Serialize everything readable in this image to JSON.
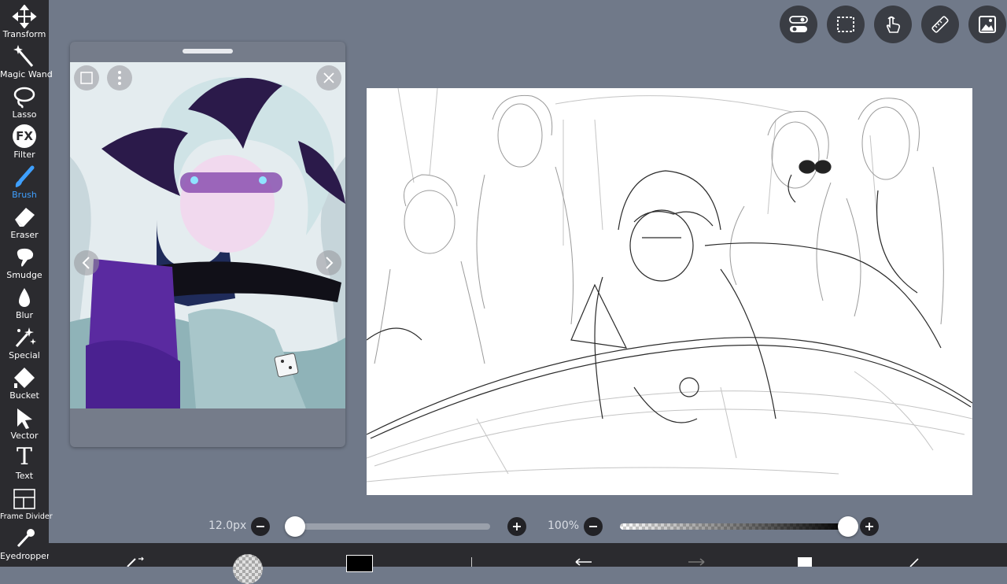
{
  "toolbar": {
    "tools": [
      {
        "label": "Transform",
        "icon": "move-arrows-icon"
      },
      {
        "label": "Magic Wand",
        "icon": "magic-wand-icon"
      },
      {
        "label": "Lasso",
        "icon": "lasso-icon"
      },
      {
        "label": "Filter",
        "icon": "fx-icon",
        "glyph": "FX"
      },
      {
        "label": "Brush",
        "icon": "brush-icon",
        "active": true
      },
      {
        "label": "Eraser",
        "icon": "eraser-icon"
      },
      {
        "label": "Smudge",
        "icon": "smudge-icon"
      },
      {
        "label": "Blur",
        "icon": "blur-drop-icon"
      },
      {
        "label": "Special",
        "icon": "sparkle-icon"
      },
      {
        "label": "Bucket",
        "icon": "bucket-icon"
      },
      {
        "label": "Vector",
        "icon": "pointer-arrow-icon"
      },
      {
        "label": "Text",
        "icon": "text-t-icon",
        "glyph": "T"
      },
      {
        "label": "Frame Divider",
        "icon": "frame-divider-icon"
      },
      {
        "label": "Eyedropper",
        "icon": "eyedropper-icon"
      }
    ],
    "active_color": "#3fa0ff"
  },
  "top_buttons": [
    "toggle-settings-icon",
    "selection-icon",
    "hand-gesture-icon",
    "ruler-icon",
    "reference-image-icon"
  ],
  "reference_window": {
    "icons": [
      "reference-frame-icon",
      "more-menu-icon",
      "close-icon",
      "previous-arrow-icon",
      "next-arrow-icon"
    ]
  },
  "brush_size": {
    "value": "12.0px",
    "level": 0.04,
    "accent": "#3fa0ff"
  },
  "opacity": {
    "value": "100%",
    "level": 1.0
  },
  "colors": {
    "primary": "#000000",
    "panel_bg": "#2b2b2f",
    "workspace_bg": "#707989"
  }
}
